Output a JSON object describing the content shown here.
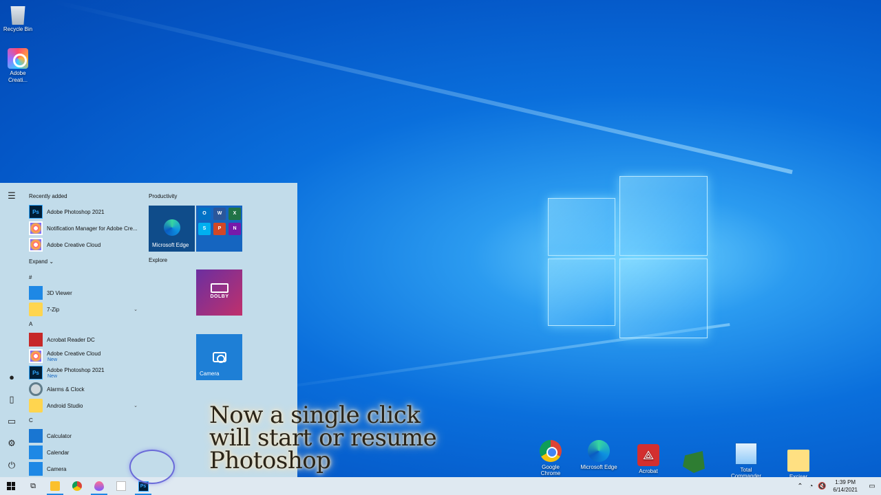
{
  "desktop": {
    "icons": [
      {
        "label": "Recycle Bin"
      },
      {
        "label": "Adobe Creati..."
      }
    ],
    "bottom_icons": [
      {
        "label": "Google Chrome"
      },
      {
        "label": "Microsoft Edge"
      },
      {
        "label": "Acrobat"
      },
      {
        "label": ""
      },
      {
        "label": "Total Commander"
      },
      {
        "label": "Exciser"
      }
    ]
  },
  "start_menu": {
    "recently_added_header": "Recently added",
    "recent": [
      {
        "label": "Adobe Photoshop 2021",
        "icon": "photoshop-icon",
        "glyph": "Ps"
      },
      {
        "label": "Notification Manager for Adobe Cre...",
        "icon": "creative-cloud-icon"
      },
      {
        "label": "Adobe Creative Cloud",
        "icon": "creative-cloud-icon"
      }
    ],
    "expand_label": "Expand",
    "groups": [
      {
        "letter": "#",
        "apps": [
          {
            "label": "3D Viewer",
            "icon": "3d-viewer-icon"
          },
          {
            "label": "7-Zip",
            "icon": "folder-icon",
            "expandable": true
          }
        ]
      },
      {
        "letter": "A",
        "apps": [
          {
            "label": "Acrobat Reader DC",
            "icon": "acrobat-icon"
          },
          {
            "label": "Adobe Creative Cloud",
            "icon": "creative-cloud-icon",
            "badge": "New"
          },
          {
            "label": "Adobe Photoshop 2021",
            "icon": "photoshop-icon",
            "badge": "New",
            "glyph": "Ps"
          },
          {
            "label": "Alarms & Clock",
            "icon": "clock-icon"
          },
          {
            "label": "Android Studio",
            "icon": "folder-icon",
            "expandable": true
          }
        ]
      },
      {
        "letter": "C",
        "apps": [
          {
            "label": "Calculator",
            "icon": "calculator-icon"
          },
          {
            "label": "Calendar",
            "icon": "calendar-icon"
          },
          {
            "label": "Camera",
            "icon": "camera-icon"
          }
        ]
      }
    ],
    "tile_groups": {
      "productivity": "Productivity",
      "explore": "Explore"
    },
    "tiles": {
      "edge": "Microsoft Edge",
      "dolby": "DOLBY",
      "camera": "Camera",
      "office_minis": [
        "O",
        "W",
        "X",
        "S",
        "P",
        "N"
      ]
    }
  },
  "caption": {
    "line1": "Now a single click",
    "line2": "will start or resume",
    "line3": "Photoshop"
  },
  "taskbar": {
    "time": "1:39 PM",
    "date": "6/14/2021",
    "photoshop_glyph": "Ps"
  },
  "colors": {
    "accent": "#1e88e5",
    "start_bg": "#c2dcea",
    "taskbar_bg": "#dfe9f1"
  }
}
